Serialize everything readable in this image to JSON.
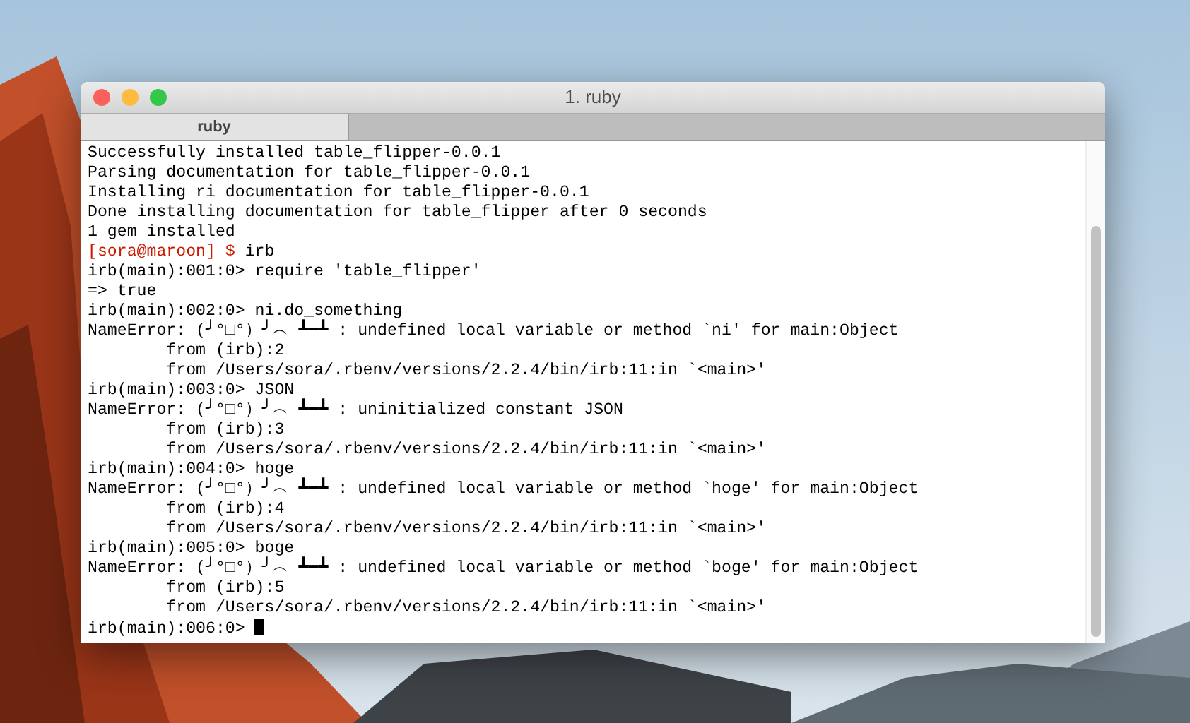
{
  "window": {
    "title": "1. ruby"
  },
  "tabs": [
    {
      "label": "ruby",
      "selected": true
    }
  ],
  "terminal": {
    "lines": [
      {
        "kind": "output",
        "text": "Successfully installed table_flipper-0.0.1"
      },
      {
        "kind": "output",
        "text": "Parsing documentation for table_flipper-0.0.1"
      },
      {
        "kind": "output",
        "text": "Installing ri documentation for table_flipper-0.0.1"
      },
      {
        "kind": "output",
        "text": "Done installing documentation for table_flipper after 0 seconds"
      },
      {
        "kind": "output",
        "text": "1 gem installed"
      },
      {
        "kind": "shell",
        "prompt": "[sora@maroon] $",
        "text": "irb"
      },
      {
        "kind": "output",
        "text": "irb(main):001:0> require 'table_flipper'"
      },
      {
        "kind": "output",
        "text": "=> true"
      },
      {
        "kind": "output",
        "text": "irb(main):002:0> ni.do_something"
      },
      {
        "kind": "output",
        "text": "NameError: (╯°□°）╯︵ ┻━┻ : undefined local variable or method `ni' for main:Object"
      },
      {
        "kind": "output",
        "text": "        from (irb):2"
      },
      {
        "kind": "output",
        "text": "        from /Users/sora/.rbenv/versions/2.2.4/bin/irb:11:in `<main>'"
      },
      {
        "kind": "output",
        "text": "irb(main):003:0> JSON"
      },
      {
        "kind": "output",
        "text": "NameError: (╯°□°）╯︵ ┻━┻ : uninitialized constant JSON"
      },
      {
        "kind": "output",
        "text": "        from (irb):3"
      },
      {
        "kind": "output",
        "text": "        from /Users/sora/.rbenv/versions/2.2.4/bin/irb:11:in `<main>'"
      },
      {
        "kind": "output",
        "text": "irb(main):004:0> hoge"
      },
      {
        "kind": "output",
        "text": "NameError: (╯°□°）╯︵ ┻━┻ : undefined local variable or method `hoge' for main:Object"
      },
      {
        "kind": "output",
        "text": "        from (irb):4"
      },
      {
        "kind": "output",
        "text": "        from /Users/sora/.rbenv/versions/2.2.4/bin/irb:11:in `<main>'"
      },
      {
        "kind": "output",
        "text": "irb(main):005:0> boge"
      },
      {
        "kind": "output",
        "text": "NameError: (╯°□°）╯︵ ┻━┻ : undefined local variable or method `boge' for main:Object"
      },
      {
        "kind": "output",
        "text": "        from (irb):5"
      },
      {
        "kind": "output",
        "text": "        from /Users/sora/.rbenv/versions/2.2.4/bin/irb:11:in `<main>'"
      },
      {
        "kind": "cursor",
        "text": "irb(main):006:0> "
      }
    ]
  }
}
